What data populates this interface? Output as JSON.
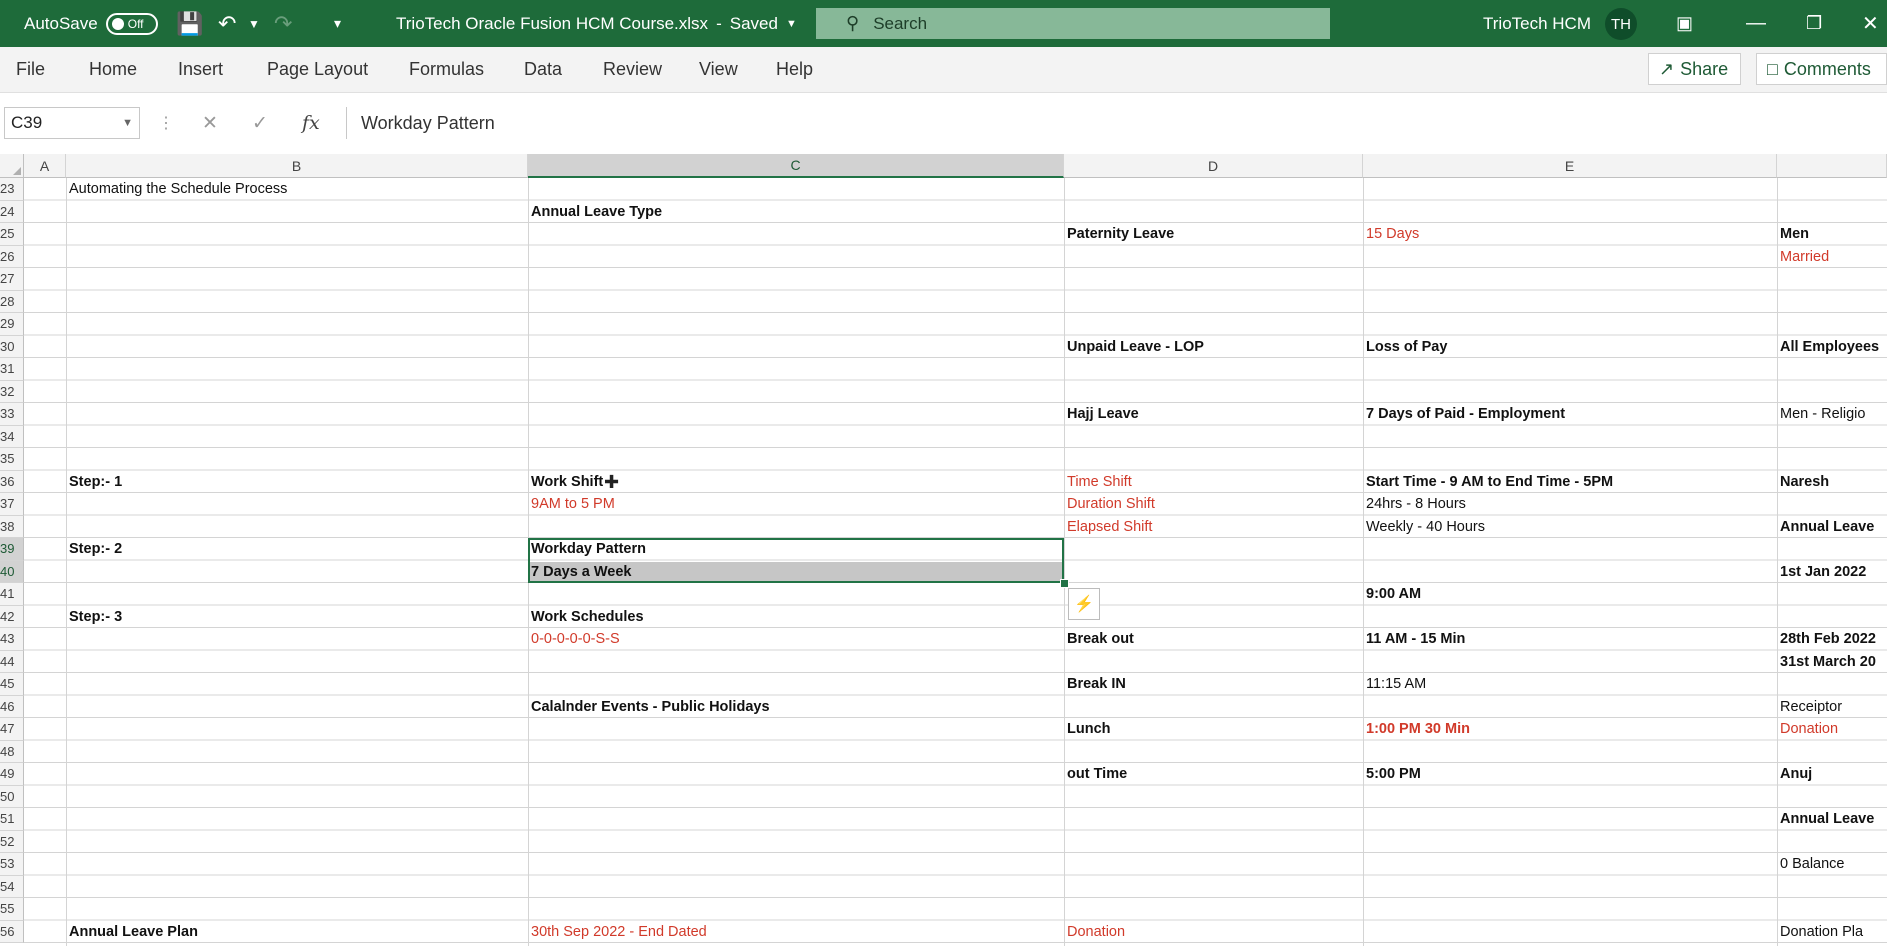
{
  "titlebar": {
    "autosave_label": "AutoSave",
    "autosave_state": "Off",
    "file_title": "TrioTech Oracle Fusion HCM Course.xlsx",
    "saved_status": "Saved",
    "search_placeholder": "Search",
    "account_name": "TrioTech HCM",
    "avatar_initials": "TH"
  },
  "ribbon": {
    "tabs": [
      "File",
      "Home",
      "Insert",
      "Page Layout",
      "Formulas",
      "Data",
      "Review",
      "View",
      "Help"
    ],
    "share_label": "Share",
    "comments_label": "Comments"
  },
  "formula_bar": {
    "name_box": "C39",
    "fx_label": "fx",
    "content": "Workday Pattern"
  },
  "columns": [
    "A",
    "B",
    "C",
    "D",
    "E"
  ],
  "selected_column": "C",
  "rows": [
    "23",
    "24",
    "25",
    "26",
    "27",
    "28",
    "29",
    "30",
    "31",
    "32",
    "33",
    "34",
    "35",
    "36",
    "37",
    "38",
    "39",
    "40",
    "41",
    "42",
    "43",
    "44",
    "45",
    "46",
    "47",
    "48",
    "49",
    "50",
    "51",
    "52",
    "53",
    "54",
    "55",
    "56"
  ],
  "selected_rows": [
    "39",
    "40"
  ],
  "cells": {
    "B23": "Automating the Schedule Process",
    "C24": "Annual Leave Type",
    "D25": "Paternity Leave",
    "E25": "15 Days",
    "F25": "Men",
    "F26": "Married",
    "D30": "Unpaid Leave - LOP",
    "E30": "Loss of Pay",
    "F30": "All Employees",
    "D33": "Hajj Leave",
    "E33": "7 Days of Paid - Employment",
    "F33": "Men - Religio",
    "B36": "Step:- 1",
    "C36": "Work Shift",
    "D36": "Time Shift",
    "E36": "Start Time - 9 AM to End Time - 5PM",
    "F36": "Naresh",
    "C37": "9AM to 5 PM",
    "D37": "Duration Shift",
    "E37": "24hrs - 8 Hours",
    "D38": "Elapsed Shift",
    "E38": "Weekly - 40 Hours",
    "F38": "Annual Leave",
    "B39": "Step:- 2",
    "C39": "Workday Pattern",
    "C40": "7 Days a Week",
    "F40": "1st Jan 2022",
    "E41": "9:00 AM",
    "B42": "Step:- 3",
    "C42": "Work Schedules",
    "C43": "0-0-0-0-0-S-S",
    "D43": "Break out",
    "E43": "11 AM - 15 Min",
    "F43": "28th Feb 2022",
    "F44": "31st March 20",
    "D45": "Break IN",
    "E45": "11:15 AM",
    "C46": "Calalnder Events - Public Holidays",
    "F46": "Receiptor",
    "D47": "Lunch",
    "E47": "1:00 PM 30 Min",
    "F47": "Donation",
    "D49": "out Time",
    "E49": "5:00 PM",
    "F49": "Anuj",
    "F51": "Annual Leave",
    "F53": "0 Balance",
    "B56": "Annual Leave Plan",
    "C56": "30th Sep 2022 - End Dated",
    "D56": "Donation",
    "F56": "Donation Pla"
  },
  "colors": {
    "title_green": "#1e6b3a",
    "accent_green": "#217346",
    "red_text": "#d13a2a"
  }
}
